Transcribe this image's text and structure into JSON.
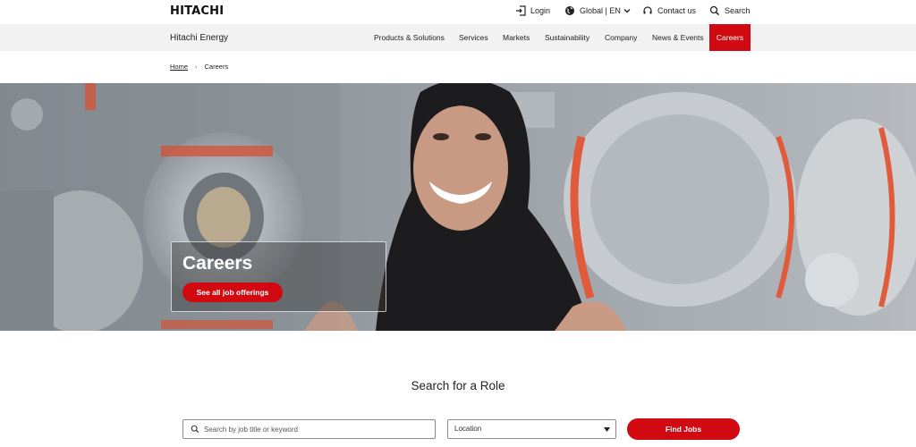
{
  "topbar": {
    "logo": "HITACHI",
    "login": "Login",
    "global": "Global | EN",
    "contact": "Contact us",
    "search": "Search"
  },
  "nav": {
    "brand": "Hitachi Energy",
    "items": [
      "Products & Solutions",
      "Services",
      "Markets",
      "Sustainability",
      "Company",
      "News & Events",
      "Careers"
    ],
    "active": "Careers"
  },
  "breadcrumb": {
    "home": "Home",
    "current": "Careers"
  },
  "hero": {
    "title": "Careers",
    "button": "See all job offerings"
  },
  "search_section": {
    "title": "Search for a Role",
    "keyword_placeholder": "Search by job title or keyword",
    "location_value": "Location",
    "find_button": "Find Jobs"
  },
  "colors": {
    "accent": "#d10a11",
    "nav_bg": "#f2f2f2"
  }
}
